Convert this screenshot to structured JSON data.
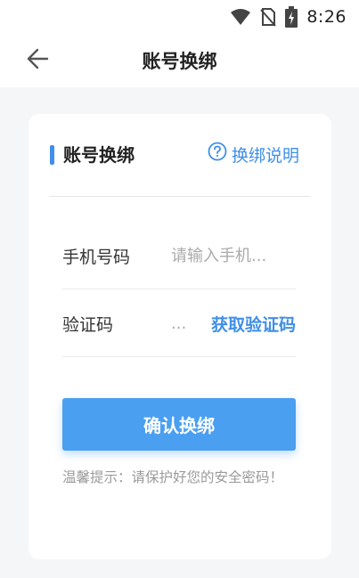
{
  "status_bar": {
    "time": "8:26",
    "icons": [
      "wifi-icon",
      "no-sim-icon",
      "battery-icon"
    ]
  },
  "app_bar": {
    "title": "账号换绑",
    "back_icon": "arrow-left-icon"
  },
  "card": {
    "title": "账号换绑",
    "help_icon": "question-circle-icon",
    "help_label": "换绑说明",
    "phone_label": "手机号码",
    "phone_placeholder": "请输入手机...",
    "phone_value": "",
    "code_label": "验证码",
    "code_placeholder": "...",
    "code_value": "",
    "get_code_label": "获取验证码",
    "confirm_label": "确认换绑",
    "tip": "温馨提示：请保护好您的安全密码！"
  },
  "colors": {
    "accent": "#3f8fe9",
    "button": "#4a9ff0",
    "background": "#f5f6f7"
  }
}
